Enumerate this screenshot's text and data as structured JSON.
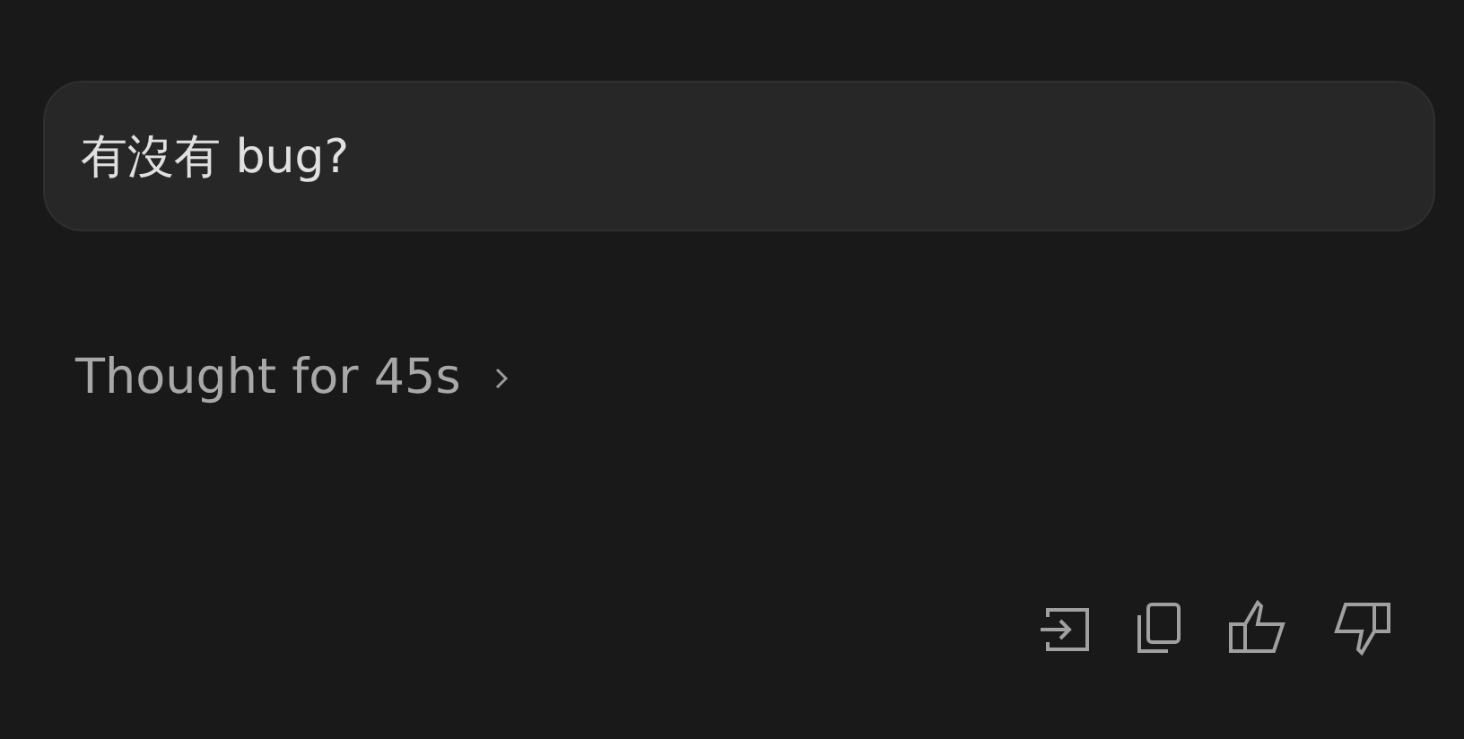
{
  "message": {
    "text": "有沒有 bug?"
  },
  "thought": {
    "label": "Thought for 45s",
    "expanded": false
  },
  "actions": [
    {
      "kind": "insert"
    },
    {
      "kind": "copy"
    },
    {
      "kind": "like"
    },
    {
      "kind": "dislike"
    }
  ]
}
